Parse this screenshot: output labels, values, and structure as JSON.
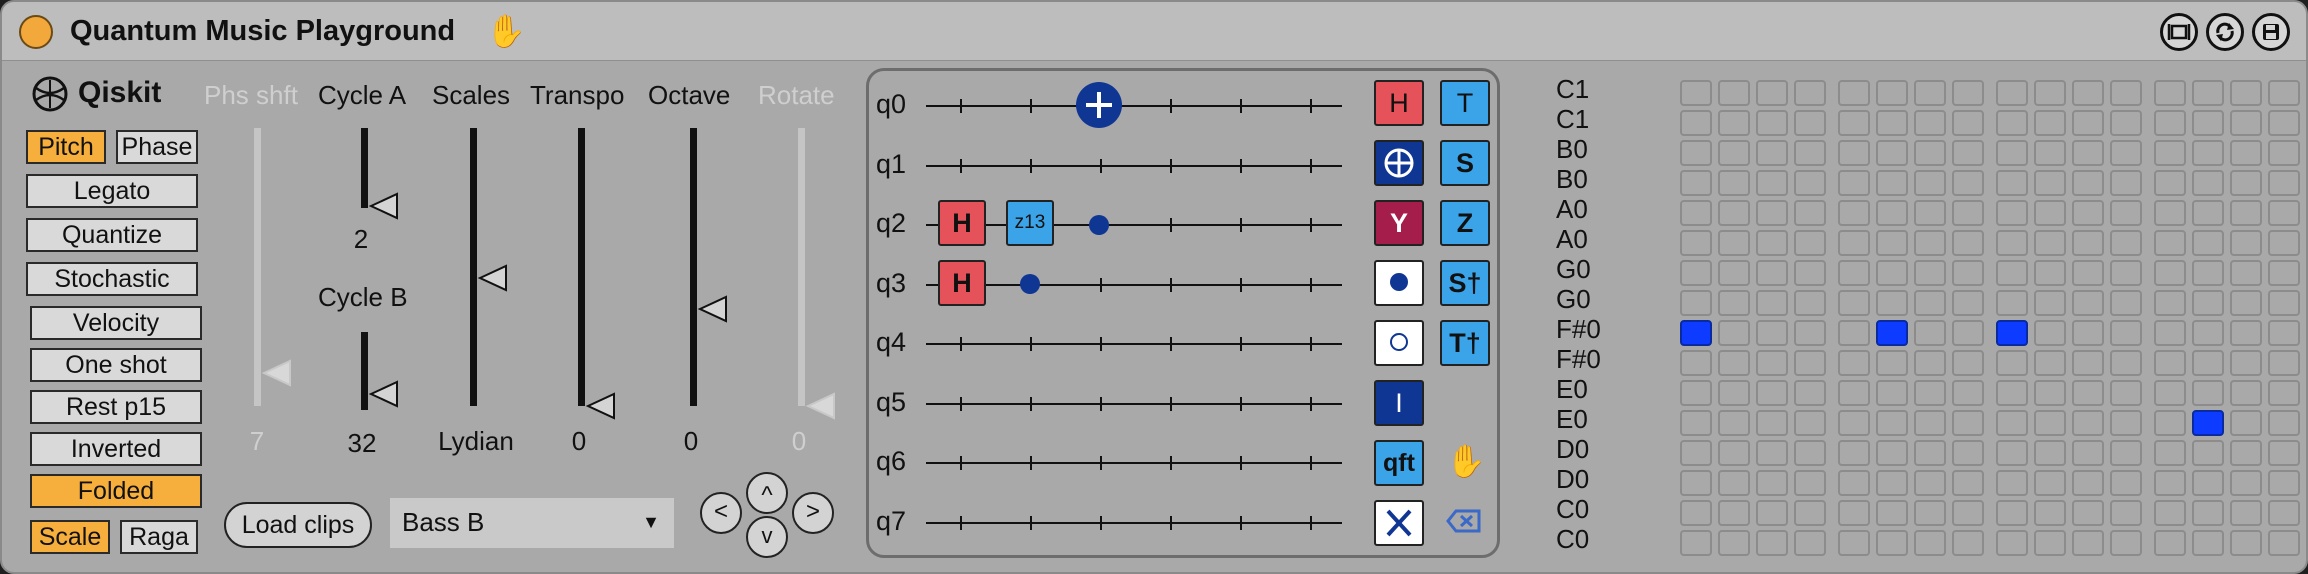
{
  "window": {
    "title": "Quantum Music Playground",
    "hand_icon": "hand-icon"
  },
  "titlebar_buttons": [
    "fullscreen-icon",
    "refresh-icon",
    "save-icon"
  ],
  "logo": {
    "text": "Qiskit",
    "icon": "qiskit-atom-icon"
  },
  "toggles": {
    "pitch": "Pitch",
    "phase": "Phase",
    "legato": "Legato",
    "quantize": "Quantize",
    "stochastic": "Stochastic",
    "velocity": "Velocity",
    "one_shot": "One shot",
    "rest_p15": "Rest p15",
    "inverted": "Inverted",
    "folded": "Folded",
    "scale": "Scale",
    "raga": "Raga"
  },
  "toggle_states": {
    "pitch": true,
    "folded": true,
    "scale": true
  },
  "sliders": {
    "phs_shft": {
      "label": "Phs shft",
      "value": "7",
      "level": 0.12
    },
    "cycle_a": {
      "label": "Cycle A",
      "value": "2",
      "level": 0.02
    },
    "cycle_b": {
      "label": "Cycle B",
      "value": "32",
      "level": 0.2
    },
    "scales": {
      "label": "Scales",
      "value": "Lydian",
      "level": 0.46
    },
    "transpo": {
      "label": "Transpo",
      "value": "0",
      "level": 0.0
    },
    "octave": {
      "label": "Octave",
      "value": "0",
      "level": 0.35
    },
    "rotate": {
      "label": "Rotate",
      "value": "0",
      "level": 0.0
    }
  },
  "buttons": {
    "load_clips": "Load clips",
    "nav_left": "<",
    "nav_up": "^",
    "nav_down": "v",
    "nav_right": ">"
  },
  "dropdown": {
    "selected": "Bass B",
    "arrow": "▼"
  },
  "circuit": {
    "qubits": [
      "q0",
      "q1",
      "q2",
      "q3",
      "q4",
      "q5",
      "q6",
      "q7"
    ],
    "placed": {
      "q2_h": "H",
      "q2_rz": "z13",
      "q3_h": "H"
    }
  },
  "palette": {
    "h": "H",
    "t": "T",
    "s": "S",
    "y": "Y",
    "z": "Z",
    "sdg": "S†",
    "tdg": "T†",
    "i": "I",
    "qft": "qft",
    "icons": [
      "cnot-target-icon",
      "control-dot-icon",
      "anti-control-dot-icon",
      "x-icon",
      "hand-icon",
      "backspace-icon"
    ]
  },
  "notes": [
    "C1",
    "C1",
    "B0",
    "B0",
    "A0",
    "A0",
    "G0",
    "G0",
    "F#0",
    "F#0",
    "E0",
    "E0",
    "D0",
    "D0",
    "C0",
    "C0"
  ],
  "sequencer": {
    "columns": 16,
    "active": [
      {
        "row": 8,
        "col": 0
      },
      {
        "row": 8,
        "col": 5
      },
      {
        "row": 8,
        "col": 8
      },
      {
        "row": 11,
        "col": 13
      }
    ]
  },
  "colors": {
    "accent": "#f6ae3c",
    "gate_red": "#e5525a",
    "gate_light_blue": "#3ba3e8",
    "gate_dark_blue": "#103693",
    "active_step": "#0d3bff"
  }
}
